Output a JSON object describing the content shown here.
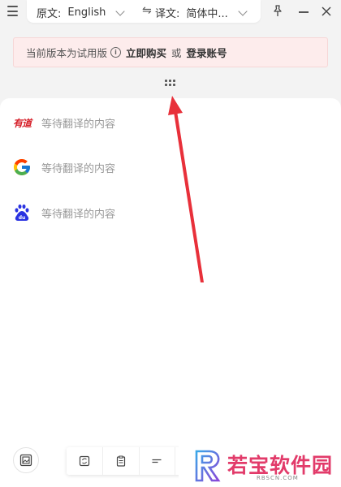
{
  "topbar": {
    "source_label": "原文:",
    "source_lang": "English",
    "target_label": "译文:",
    "target_lang": "简体中..."
  },
  "banner": {
    "text": "当前版本为试用版",
    "buy_label": "立即购买",
    "or_text": "或",
    "login_label": "登录账号"
  },
  "engines": [
    {
      "name": "有道",
      "icon": "youdao-logo",
      "status": "等待翻译的内容"
    },
    {
      "name": "Google",
      "icon": "google-logo",
      "status": "等待翻译的内容"
    },
    {
      "name": "Baidu",
      "icon": "baidu-logo",
      "status": "等待翻译的内容"
    }
  ],
  "watermark": {
    "text": "若宝软件园",
    "sub": "RBSCN.COM"
  },
  "colors": {
    "banner_bg": "#fdecec",
    "arrow": "#e8303a",
    "youdao_red": "#d6202a",
    "baidu_blue": "#2932e1",
    "watermark_pink": "#e23b6a"
  }
}
